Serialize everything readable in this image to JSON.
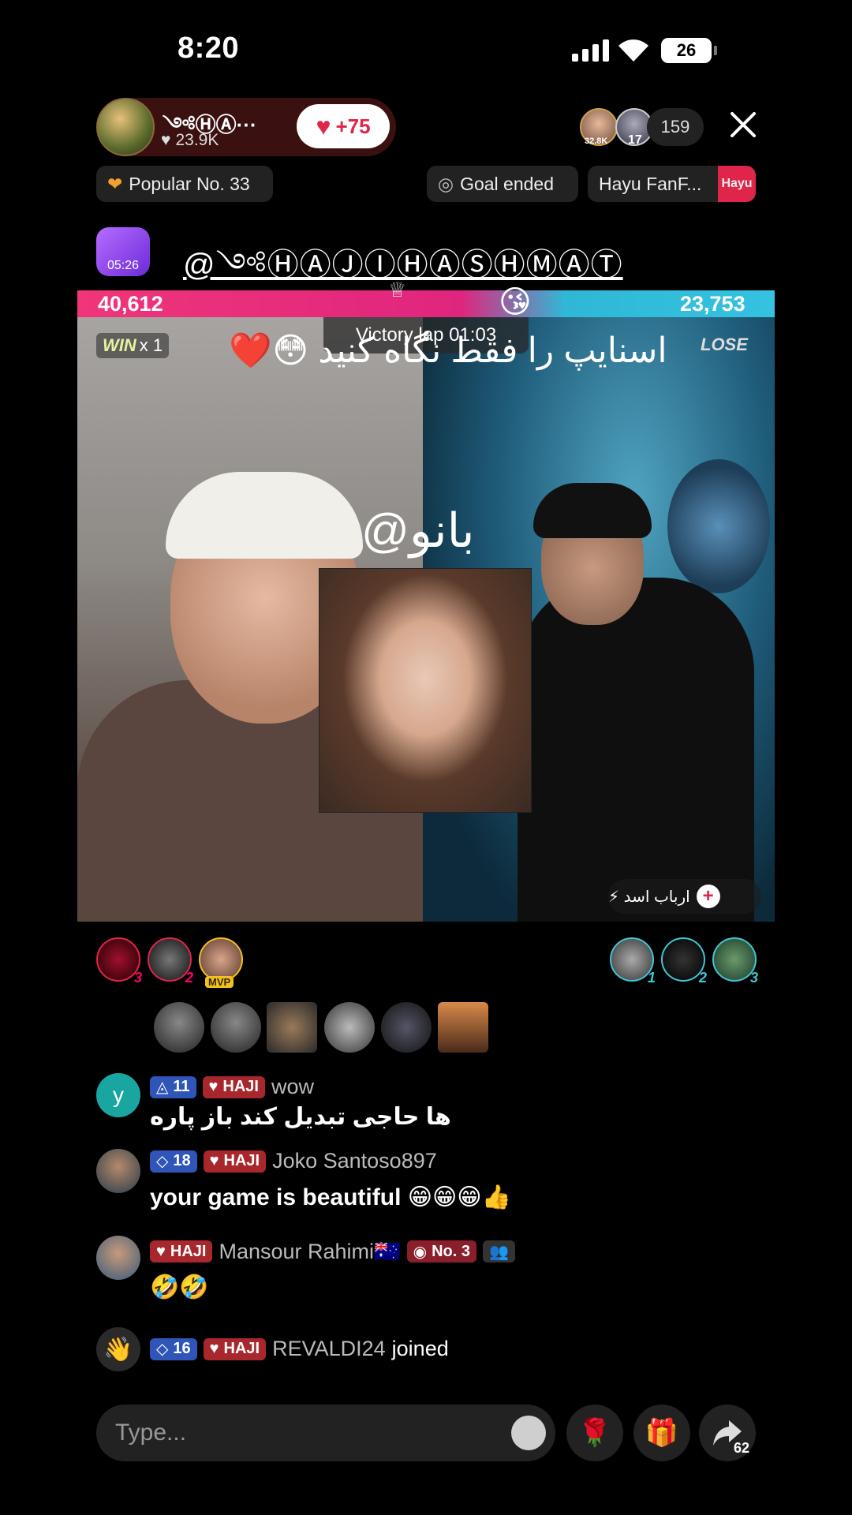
{
  "status": {
    "time": "8:20",
    "battery": "26"
  },
  "host": {
    "name": "༺ⒽⒶ···",
    "likes": "23.9K",
    "like_button": "+75"
  },
  "viewers": {
    "v1_badge": "32.8K",
    "v2_badge": "17",
    "count": "159"
  },
  "chips": {
    "popular": "Popular No. 33",
    "goal": "Goal ended",
    "fanfest": "Hayu FanF...",
    "fanfest_logo": "Hayu"
  },
  "overlay": {
    "gift_timer": "05:26",
    "mention": "@༺ⒽⒶⒿⒾⒽⒶⓈⒽⓂⒶⓉ"
  },
  "battle": {
    "score_left": "40,612",
    "score_right": "23,753",
    "win_label": "WIN",
    "win_count": "x 1",
    "lose_label": "LOSE",
    "victory": "Victory lap 01:03",
    "farsi_caption": "اسنایپ را فقط نگاه کنید 😳❤️",
    "center_mention": "@بانو",
    "follow_chip": "ارباب اسد ⚡"
  },
  "ranking": {
    "left": [
      {
        "num": "3"
      },
      {
        "num": "2"
      },
      {
        "num": "MVP"
      }
    ],
    "right": [
      {
        "num": "1"
      },
      {
        "num": "2"
      },
      {
        "num": "3"
      }
    ]
  },
  "chat": [
    {
      "avatar_letter": "y",
      "level": "11",
      "fan": "HAJI",
      "user": "wow",
      "message": "ها حاجی تبدیل کند باز پاره"
    },
    {
      "level": "18",
      "fan": "HAJI",
      "user": "Joko Santoso897",
      "message": "your game is beautiful 😁😁😁👍"
    },
    {
      "fan": "HAJI",
      "user": "Mansour Rahimi🇦🇺",
      "rank_badge": "No. 3",
      "message": "🤣🤣"
    },
    {
      "level": "16",
      "fan": "HAJI",
      "user": "REVALDI24",
      "action": "joined"
    }
  ],
  "bottom": {
    "placeholder": "Type...",
    "share_count": "62"
  },
  "colors": {
    "accent": "#e0254b",
    "blue_team": "#34c2e0",
    "pink_team": "#f0357a"
  }
}
